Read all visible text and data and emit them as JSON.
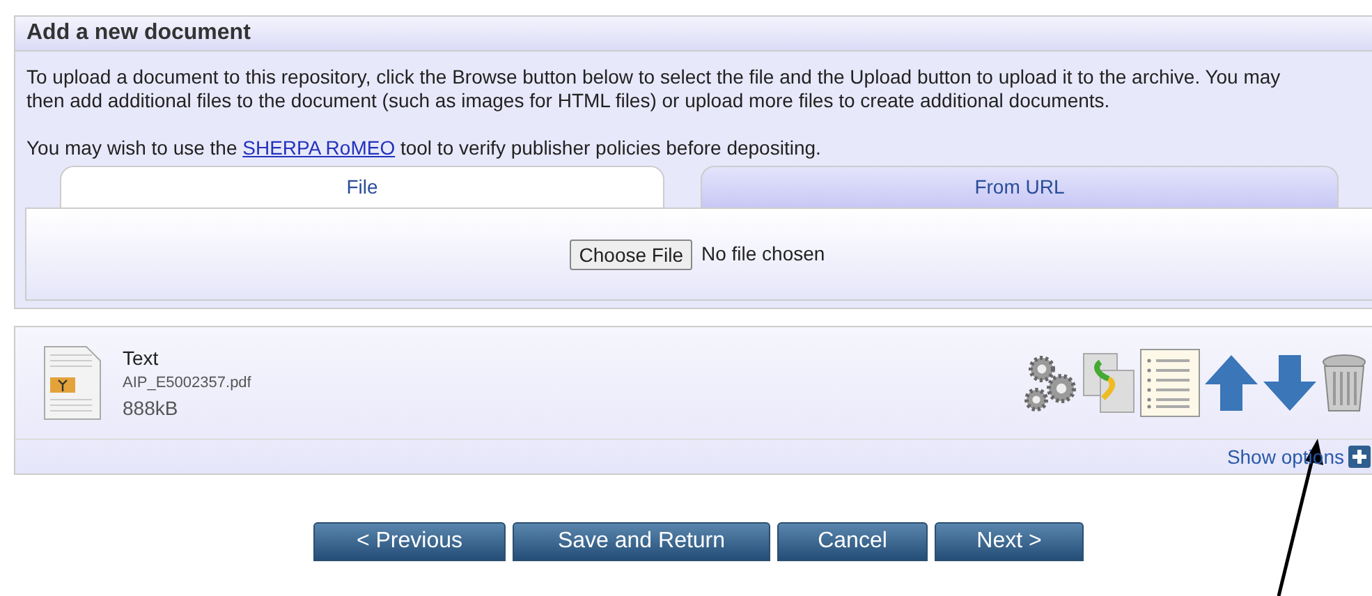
{
  "panel": {
    "title": "Add a new document",
    "intro": "To upload a document to this repository, click the Browse button below to select the file and the Upload button to upload it to the archive. You may then add additional files to the document (such as images for HTML files) or upload more files to create additional documents.",
    "hint_before": "You may wish to use the",
    "hint_link": "SHERPA RoMEO",
    "hint_after": "tool to verify publisher policies before depositing."
  },
  "tabs": [
    {
      "label": "File",
      "selected": true
    },
    {
      "label": "From URL",
      "selected": false
    }
  ],
  "file_input": {
    "button": "Choose File",
    "status": "No file chosen"
  },
  "document": {
    "format": "Text",
    "filename": "AIP_E5002357.pdf",
    "size": "888kB",
    "show_options": "Show options"
  },
  "buttons": [
    "< Previous",
    "Save and Return",
    "Cancel",
    "Next >"
  ]
}
